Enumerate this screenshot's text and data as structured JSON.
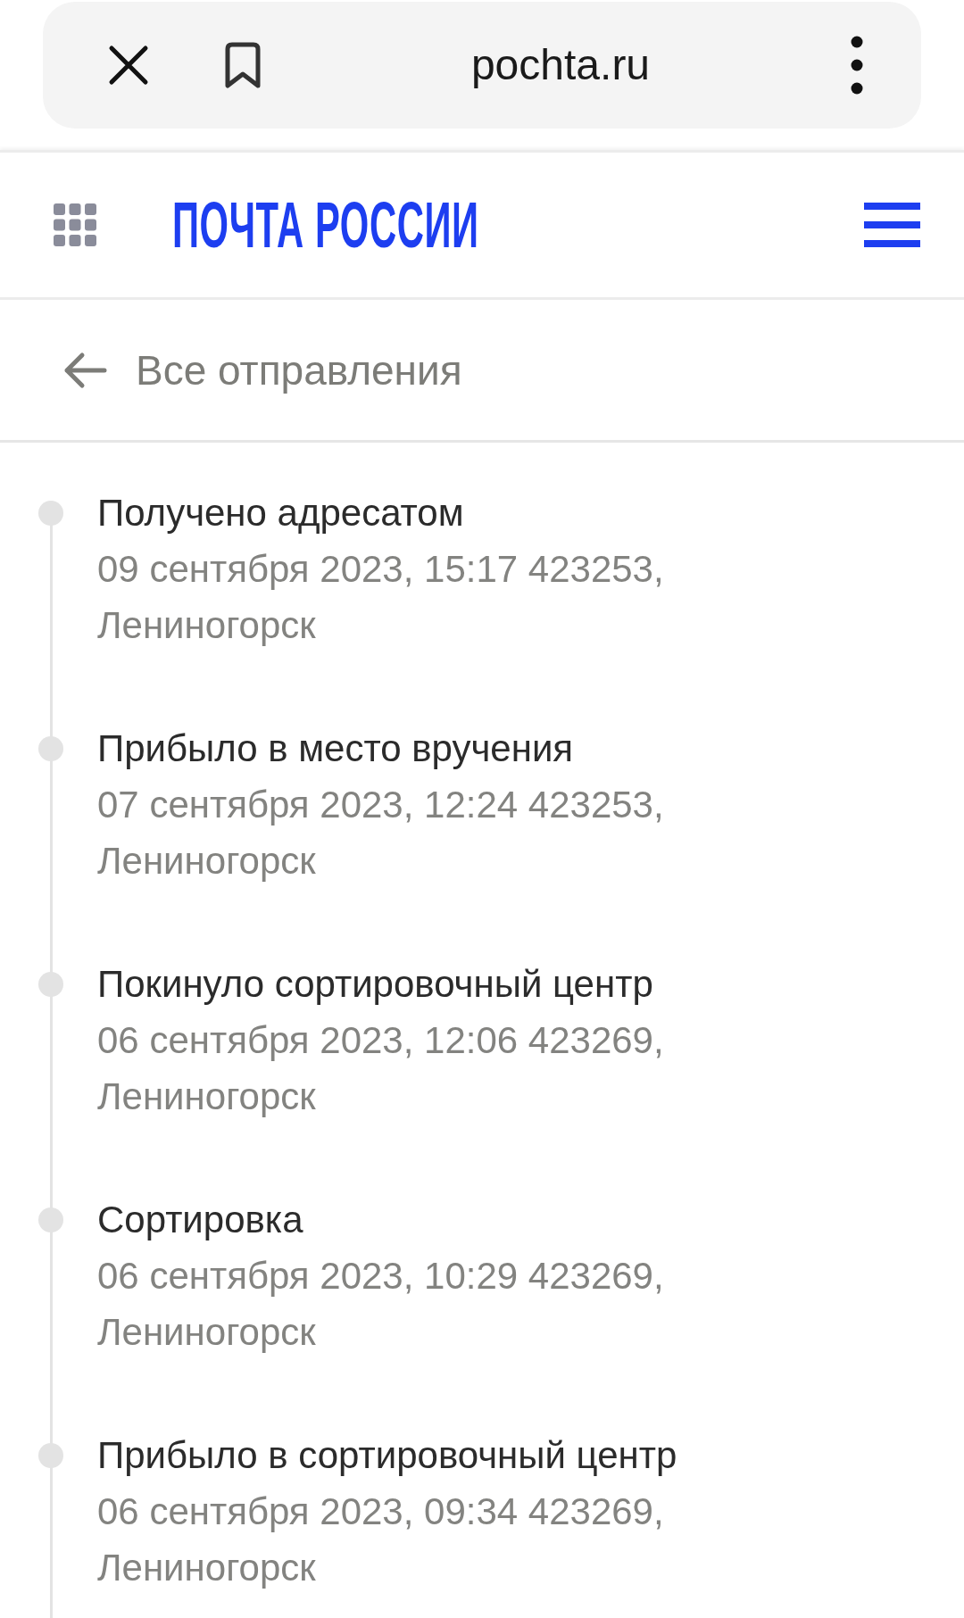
{
  "browser_bar": {
    "url": "pochta.ru"
  },
  "header": {
    "logo": "ПОЧТА РОССИИ"
  },
  "back_link": {
    "label": "Все отправления"
  },
  "events": [
    {
      "status": "Получено адресатом",
      "details": "09 сентября 2023, 15:17 423253, Лениногорск"
    },
    {
      "status": "Прибыло в место вручения",
      "details": "07 сентября 2023, 12:24 423253, Лениногорск"
    },
    {
      "status": "Покинуло сортировочный центр",
      "details": "06 сентября 2023, 12:06 423269, Лениногорск"
    },
    {
      "status": "Сортировка",
      "details": "06 сентября 2023, 10:29 423269, Лениногорск"
    },
    {
      "status": "Прибыло в сортировочный центр",
      "details": "06 сентября 2023, 09:34 423269, Лениногорск"
    }
  ]
}
